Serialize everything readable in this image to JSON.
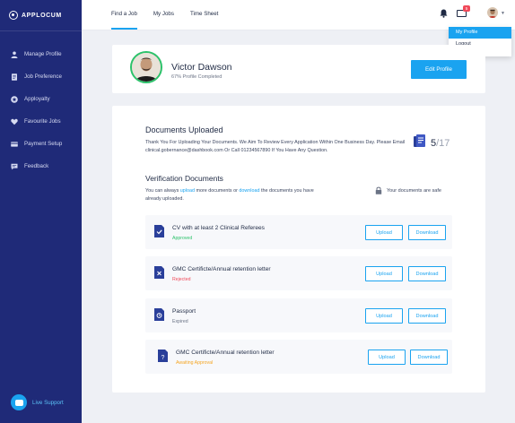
{
  "app": {
    "logo_text": "APPLOCUM"
  },
  "sidebar": {
    "items": [
      {
        "label": "Manage Profile",
        "icon": "user-icon"
      },
      {
        "label": "Job Preference",
        "icon": "document-icon"
      },
      {
        "label": "Apployalty",
        "icon": "star-icon"
      },
      {
        "label": "Favourite Jobs",
        "icon": "heart-icon"
      },
      {
        "label": "Payment Setup",
        "icon": "card-icon"
      },
      {
        "label": "Feedback",
        "icon": "chat-icon"
      }
    ],
    "live_support": "Live Support"
  },
  "topbar": {
    "tabs": [
      {
        "label": "Find a Job",
        "active": true
      },
      {
        "label": "My Jobs",
        "active": false
      },
      {
        "label": "Time Sheet",
        "active": false
      }
    ],
    "mail_badge": "5"
  },
  "user_menu": {
    "items": [
      {
        "label": "My Profile",
        "active": true
      },
      {
        "label": "Logout",
        "active": false
      }
    ]
  },
  "profile": {
    "name": "Victor Dawson",
    "completion": "67% Profile Completed",
    "edit_label": "Edit Profile"
  },
  "documents": {
    "title": "Documents Uploaded",
    "description": "Thank You For Uploading Your Documents. We Aim To Review Every Application Within One Business Day. Please Email clinical.gobernance@dashbook.com Or Call 01234567890 If You Have Any Question.",
    "count_uploaded": "5",
    "count_total": "/17"
  },
  "verification": {
    "title": "Verification Documents",
    "desc_prefix": "You can always ",
    "upload_link": "upload",
    "desc_mid": " more documents or ",
    "download_link": "download",
    "desc_suffix": " the documents you have already uploaded.",
    "safe_text": "Your documents are safe",
    "upload_label": "Upload",
    "download_label": "Download",
    "rows": [
      {
        "title": "CV with at least 2 Clinical Referees",
        "status": "Approved",
        "status_color": "#2bc26a",
        "icon": "check-doc-icon"
      },
      {
        "title": "GMC Certificte/Annual retention letter",
        "status": "Rejected",
        "status_color": "#f04a5a",
        "icon": "rejected-doc-icon"
      },
      {
        "title": "Passport",
        "status": "Expired",
        "status_color": "#6b7385",
        "icon": "expired-doc-icon"
      },
      {
        "title": "GMC Certificte/Annual retention letter",
        "status": "Awaiting Approval",
        "status_color": "#f5a623",
        "icon": "pending-doc-icon"
      }
    ]
  },
  "colors": {
    "accent": "#1aa3f0",
    "sidebar": "#1f2a78",
    "approved": "#2bc26a",
    "rejected": "#f04a5a",
    "awaiting": "#f5a623"
  }
}
